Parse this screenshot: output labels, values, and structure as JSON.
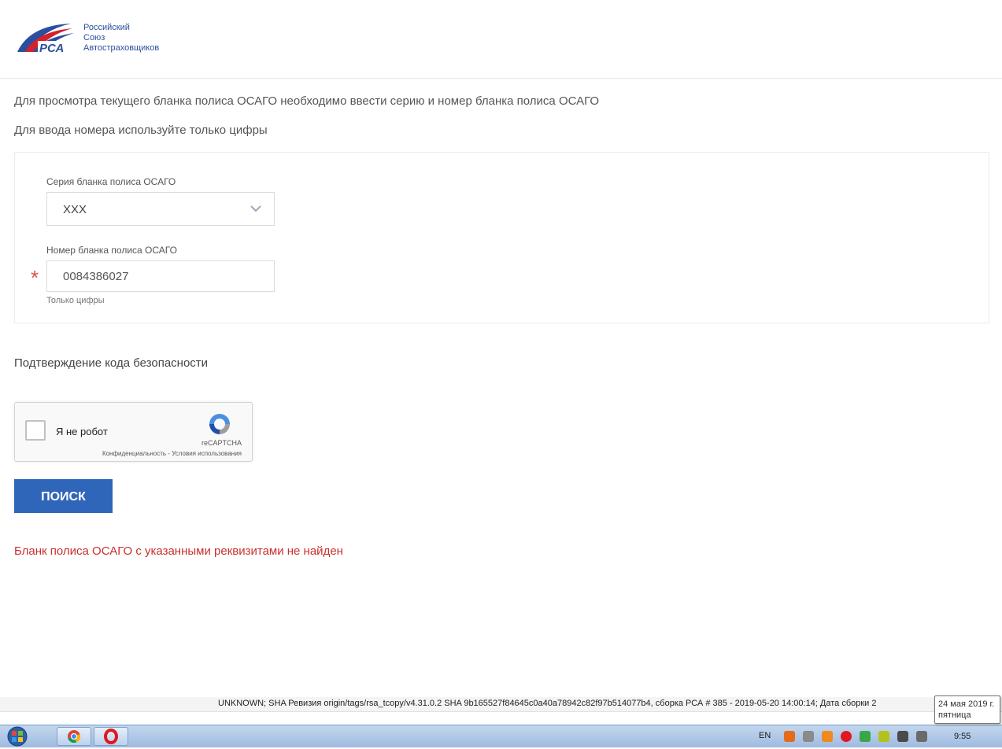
{
  "logo": {
    "abbr": "РСА",
    "line1": "Российский",
    "line2": "Союз",
    "line3": "Автостраховщиков"
  },
  "intro": {
    "line1": "Для просмотра текущего бланка полиса ОСАГО необходимо ввести серию и номер бланка полиса ОСАГО",
    "line2": "Для ввода номера используйте только цифры"
  },
  "form": {
    "series_label": "Серия бланка полиса ОСАГО",
    "series_value": "XXX",
    "number_label": "Номер бланка полиса ОСАГО",
    "number_value": "0084386027",
    "required_mark": "*",
    "number_hint": "Только цифры"
  },
  "security": {
    "title": "Подтверждение кода безопасности"
  },
  "recaptcha": {
    "label": "Я не робот",
    "brand": "reCAPTCHA",
    "links": "Конфиденциальность - Условия использования"
  },
  "search_button": "ПОИСК",
  "error_message": "Бланк полиса ОСАГО с указанными реквизитами не найден",
  "status_bar": "UNKNOWN; SHA Ревизия origin/tags/rsa_tcopy/v4.31.0.2 SHA 9b165527f84645c0a40a78942c82f97b514077b4, сборка РСА # 385 - 2019-05-20 14:00:14; Дата сборки 2",
  "tooltip": {
    "date": "24 мая 2019 г.",
    "weekday": "пятница"
  },
  "taskbar": {
    "language": "EN",
    "time": "9:55"
  },
  "colors": {
    "primary_button": "#3066b9",
    "error": "#c9302c",
    "required": "#d9534f",
    "logo_blue": "#2a4f9e"
  }
}
